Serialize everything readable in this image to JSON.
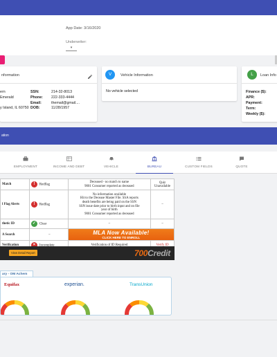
{
  "header": {
    "app_date": "App Date: 3/16/2020",
    "underwriter_label": "Underwriter:"
  },
  "customer_card": {
    "title": "nformation",
    "left_lines": [
      "ern",
      "Emerald",
      "y Island, IL 60750"
    ],
    "fields": [
      {
        "label": "SSN:",
        "value": "214-32-8013"
      },
      {
        "label": "Phone:",
        "value": "222-333-4444"
      },
      {
        "label": "Email:",
        "value": "themail@gmail...."
      },
      {
        "label": "DOB:",
        "value": "11/28/1957"
      }
    ]
  },
  "vehicle_card": {
    "icon_letter": "V",
    "title": "Vehicle Information",
    "body": "No vehicle selected"
  },
  "loan_card": {
    "icon_letter": "L",
    "title": "Loan Info",
    "fields": [
      "Finance ($):",
      "APR:",
      "Payment:",
      "Term:",
      "Weekly ($):"
    ]
  },
  "section_bar": {
    "label": "ation"
  },
  "tabs": [
    {
      "label": "EMPLOYMENT",
      "icon": "briefcase-icon"
    },
    {
      "label": "INCOME AND DEBT",
      "icon": "income-icon"
    },
    {
      "label": "VEHICLE",
      "icon": "car-icon"
    },
    {
      "label": "BUREAU",
      "icon": "bank-icon",
      "active": true
    },
    {
      "label": "CUSTOM FIELDS",
      "icon": "list-icon"
    },
    {
      "label": "QUOTE",
      "icon": "quote-icon"
    }
  ],
  "bureau_table": {
    "rows": [
      {
        "name": "Match",
        "status": "Redflag",
        "status_color": "red",
        "desc": [
          "Deceased - no match to name",
          "9001 Consumer reported as deceased"
        ],
        "quiz": [
          "Quiz",
          "Unavailable"
        ]
      },
      {
        "name": "l Flag Alerts",
        "status": "Redflag",
        "status_color": "red",
        "desc": [
          "No information available",
          "Hit to the Decease Master File. SSA reports",
          "death benefits are being paid on the SSN",
          "SSN issue date prior to birth input and on file",
          "year of birth",
          "9001 Consumer reported as deceased"
        ],
        "quiz": [
          "–"
        ]
      },
      {
        "name": "thetic ID",
        "status": "Clear",
        "status_color": "green",
        "desc": [
          "–"
        ],
        "quiz": [
          "–"
        ]
      },
      {
        "name": "A Search",
        "status": "–",
        "status_color": "none",
        "desc": [],
        "quiz": []
      },
      {
        "name": "Verification",
        "status": "Incomplete",
        "status_color": "red",
        "desc": [
          "Verification of ID Required"
        ],
        "quiz": [
          "Verify ID"
        ]
      }
    ],
    "mla_main": "MLA Now Available!",
    "mla_sub": "CLICK HERE TO ENROLL"
  },
  "credit_banner": {
    "button_label": "View Detail Report",
    "brand_num": "700",
    "brand_text": "Credit"
  },
  "summary": {
    "tab_label": "ary - OM Achem",
    "bureaus": [
      {
        "name": "Equifax",
        "color": "#b5121b"
      },
      {
        "name": "experian.",
        "color": "#1d4f91"
      },
      {
        "name": "TransUnion",
        "color": "#00a6ca"
      }
    ]
  }
}
